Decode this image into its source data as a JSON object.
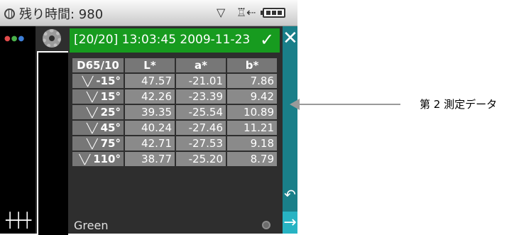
{
  "status": {
    "remaining_label": "残り時間: 980"
  },
  "header": {
    "text": "[20/20] 13:03:45 2009-11-23"
  },
  "table": {
    "headers": [
      "D65/10",
      "L*",
      "a*",
      "b*"
    ],
    "rows": [
      {
        "angle": "-15°",
        "L": "47.57",
        "a": "-21.01",
        "b": "7.86"
      },
      {
        "angle": "15°",
        "L": "42.26",
        "a": "-23.39",
        "b": "9.42"
      },
      {
        "angle": "25°",
        "L": "39.35",
        "a": "-25.54",
        "b": "10.89"
      },
      {
        "angle": "45°",
        "L": "40.24",
        "a": "-27.46",
        "b": "11.21"
      },
      {
        "angle": "75°",
        "L": "42.71",
        "a": "-27.53",
        "b": "9.18"
      },
      {
        "angle": "110°",
        "L": "38.77",
        "a": "-25.20",
        "b": "8.79"
      }
    ]
  },
  "footer": {
    "name": "Green"
  },
  "annotation": {
    "text": "第 2 測定データ"
  },
  "colors": {
    "header_green": "#179b1f",
    "side_teal": "#1a7f89",
    "next_teal": "#27b3c3"
  },
  "icons": [
    "globe-icon",
    "wifi-icon",
    "usb-icon",
    "battery-icon",
    "dots-icon",
    "gear-icon",
    "sliders-icon",
    "close-icon",
    "back-icon",
    "next-icon",
    "check-icon",
    "chevron-icon"
  ]
}
